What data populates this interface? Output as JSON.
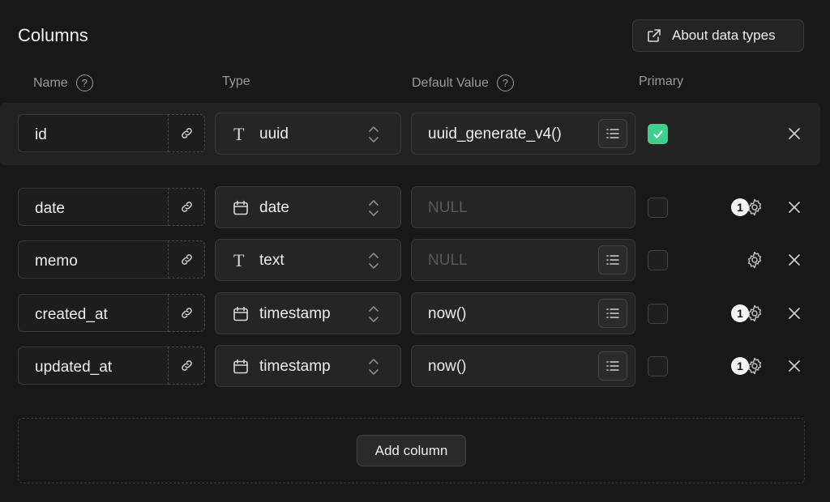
{
  "section": {
    "title": "Columns",
    "about_label": "About data types"
  },
  "headers": {
    "name": "Name",
    "type": "Type",
    "default": "Default Value",
    "primary": "Primary",
    "help_glyph": "?"
  },
  "rows": [
    {
      "name": "id",
      "type": "uuid",
      "type_icon": "text-type-icon",
      "default": "uuid_generate_v4()",
      "default_is_null": false,
      "has_list_button": true,
      "primary": true,
      "settings_badge": "",
      "show_settings": false
    },
    {
      "name": "date",
      "type": "date",
      "type_icon": "calendar-icon",
      "default": "NULL",
      "default_is_null": true,
      "has_list_button": false,
      "primary": false,
      "settings_badge": "1",
      "show_settings": true
    },
    {
      "name": "memo",
      "type": "text",
      "type_icon": "text-type-icon",
      "default": "NULL",
      "default_is_null": true,
      "has_list_button": true,
      "primary": false,
      "settings_badge": "",
      "show_settings": true
    },
    {
      "name": "created_at",
      "type": "timestamp",
      "type_icon": "calendar-icon",
      "default": "now()",
      "default_is_null": false,
      "has_list_button": true,
      "primary": false,
      "settings_badge": "1",
      "show_settings": true
    },
    {
      "name": "updated_at",
      "type": "timestamp",
      "type_icon": "calendar-icon",
      "default": "now()",
      "default_is_null": false,
      "has_list_button": true,
      "primary": false,
      "settings_badge": "1",
      "show_settings": true
    }
  ],
  "add_column_label": "Add column",
  "colors": {
    "accent": "#3ecf8e",
    "background": "#181818",
    "muted_text": "#9a9a9a"
  }
}
